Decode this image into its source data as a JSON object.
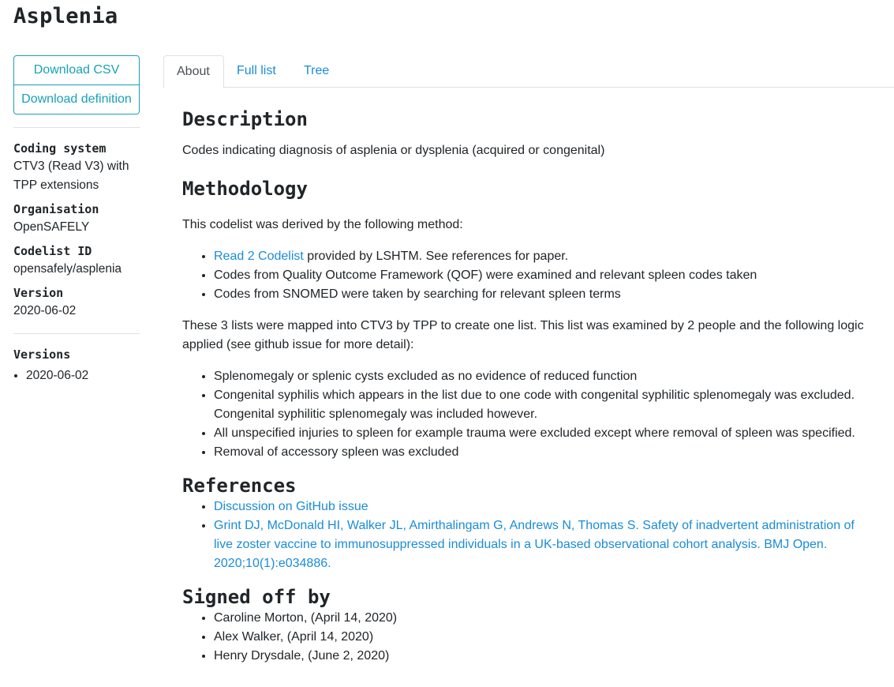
{
  "page": {
    "title": "Asplenia"
  },
  "sidebar": {
    "download_csv": "Download CSV",
    "download_definition": "Download definition",
    "meta": [
      {
        "label": "Coding system",
        "value": "CTV3 (Read V3) with TPP extensions"
      },
      {
        "label": "Organisation",
        "value": "OpenSAFELY"
      },
      {
        "label": "Codelist ID",
        "value": "opensafely/asplenia"
      },
      {
        "label": "Version",
        "value": "2020-06-02"
      }
    ],
    "versions_title": "Versions",
    "versions": [
      "2020-06-02"
    ]
  },
  "tabs": [
    "About",
    "Full list",
    "Tree"
  ],
  "about": {
    "description_heading": "Description",
    "description": "Codes indicating diagnosis of asplenia or dysplenia (acquired or congenital)",
    "methodology_heading": "Methodology",
    "methodology_intro": "This codelist was derived by the following method:",
    "methods": {
      "item1_link": "Read 2 Codelist",
      "item1_rest": " provided by LSHTM. See references for paper.",
      "item2": "Codes from Quality Outcome Framework (QOF) were examined and relevant spleen codes taken",
      "item3": "Codes from SNOMED were taken by searching for relevant spleen terms"
    },
    "mapping_text": "These 3 lists were mapped into CTV3 by TPP to create one list. This list was examined by 2 people and the following logic applied (see github issue for more detail):",
    "logic": [
      "Splenomegaly or splenic cysts excluded as no evidence of reduced function",
      "Congenital syphilis which appears in the list due to one code with congenital syphilitic splenomegaly was excluded. Congenital syphilitic splenomegaly was included however.",
      "All unspecified injuries to spleen for example trauma were excluded except where removal of spleen was specified.",
      "Removal of accessory spleen was excluded"
    ],
    "references_heading": "References",
    "references": [
      "Discussion on GitHub issue",
      "Grint DJ, McDonald HI, Walker JL, Amirthalingam G, Andrews N, Thomas S. Safety of inadvertent administration of live zoster vaccine to immunosuppressed individuals in a UK-based observational cohort analysis. BMJ Open. 2020;10(1):e034886."
    ],
    "signoff_heading": "Signed off by",
    "signoffs": [
      "Caroline Morton, (April 14, 2020)",
      "Alex Walker, (April 14, 2020)",
      "Henry Drysdale, (June 2, 2020)"
    ]
  }
}
